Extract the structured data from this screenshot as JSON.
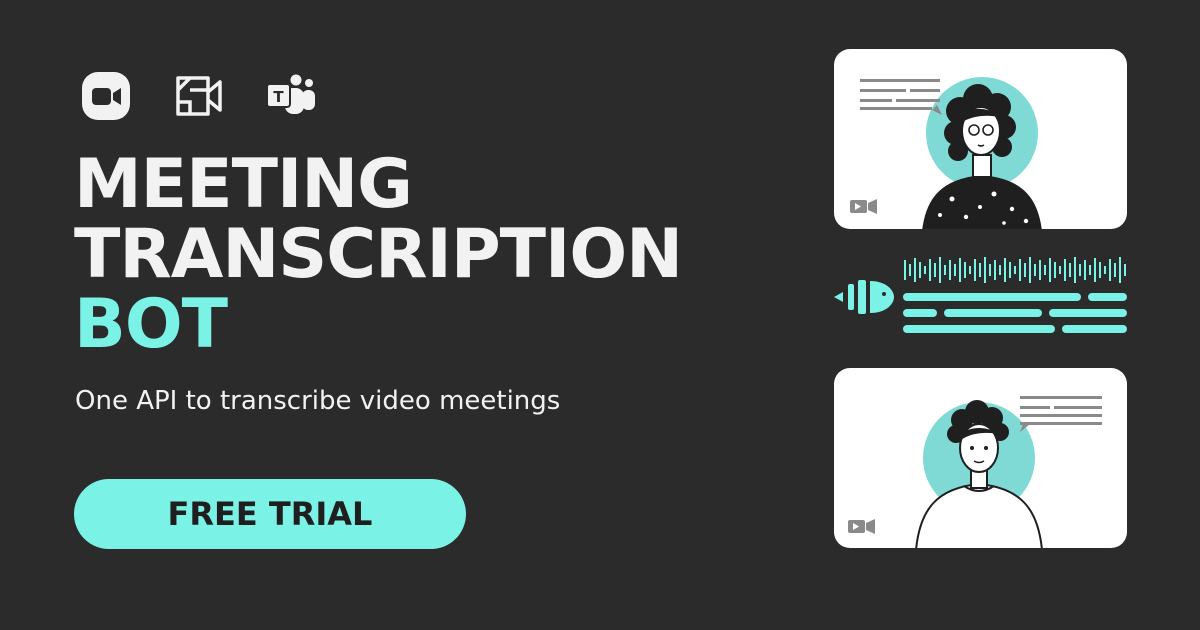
{
  "logos": [
    {
      "name": "zoom-icon"
    },
    {
      "name": "google-meet-icon"
    },
    {
      "name": "microsoft-teams-icon"
    }
  ],
  "headline": {
    "line1": "MEETING",
    "line2": "TRANSCRIPTION",
    "line3": "BOT"
  },
  "tagline": "One API to transcribe video meetings",
  "cta": {
    "label": "FREE TRIAL"
  },
  "colors": {
    "background": "#2b2b2b",
    "accent": "#7af2e6",
    "text": "#f2f2f2",
    "card": "#ffffff"
  }
}
